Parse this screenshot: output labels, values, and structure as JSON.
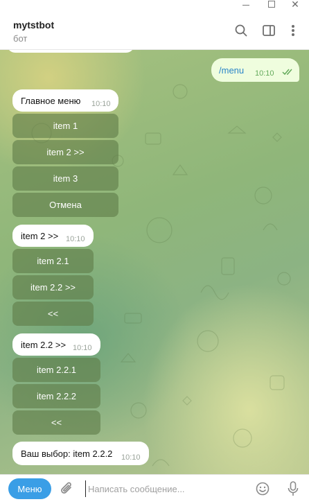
{
  "window": {
    "close_glyph": "✕"
  },
  "header": {
    "title": "mytstbot",
    "subtitle": "бот",
    "icons": [
      "search-icon",
      "sidebar-panel-icon",
      "more-vertical-icon"
    ]
  },
  "messages": {
    "outgoing": {
      "text": "/menu",
      "time": "10:10"
    },
    "main_menu": {
      "text": "Главное меню",
      "time": "10:10",
      "buttons": [
        "item 1",
        "item 2 >>",
        "item 3",
        "Отмена"
      ]
    },
    "item2": {
      "text": "item 2 >>",
      "time": "10:10",
      "buttons": [
        "item 2.1",
        "item 2.2 >>",
        "<<"
      ]
    },
    "item22": {
      "text": "item 2.2 >>",
      "time": "10:10",
      "buttons": [
        "item 2.2.1",
        "item 2.2.2",
        "<<"
      ]
    },
    "result": {
      "text": "Ваш выбор: item 2.2.2",
      "time": "10:10"
    }
  },
  "input": {
    "menu_label": "Меню",
    "placeholder": "Написать сообщение..."
  },
  "colors": {
    "accent": "#3a9ee6",
    "outgoing_bubble": "#effdde",
    "keyboard_button": "#5f7d48"
  }
}
